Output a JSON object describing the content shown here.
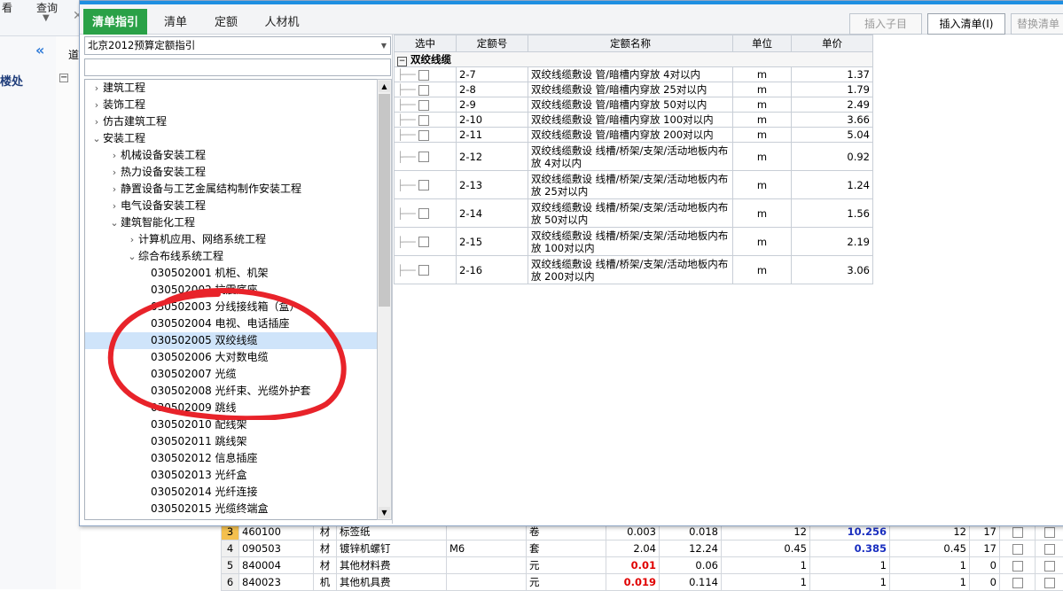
{
  "bg": {
    "toolbar_btn1": "看",
    "toolbar_btn2": "查询",
    "left_label": "楼处",
    "tab_fragment": "道"
  },
  "popup": {
    "tabs": [
      "清单指引",
      "清单",
      "定额",
      "人材机"
    ],
    "buttons": {
      "insert_child": "插入子目",
      "insert_list": "插入清单(I)",
      "replace_list": "替换清单"
    },
    "combo_value": "北京2012预算定额指引",
    "tree": [
      {
        "label": "建筑工程",
        "arrow": ">"
      },
      {
        "label": "装饰工程",
        "arrow": ">"
      },
      {
        "label": "仿古建筑工程",
        "arrow": ">"
      },
      {
        "label": "安装工程",
        "arrow": "v"
      },
      {
        "label": "机械设备安装工程",
        "arrow": ">"
      },
      {
        "label": "热力设备安装工程",
        "arrow": ">"
      },
      {
        "label": "静置设备与工艺金属结构制作安装工程",
        "arrow": ">"
      },
      {
        "label": "电气设备安装工程",
        "arrow": ">"
      },
      {
        "label": "建筑智能化工程",
        "arrow": "v"
      },
      {
        "label": "计算机应用、网络系统工程",
        "arrow": ">"
      },
      {
        "label": "综合布线系统工程",
        "arrow": "v"
      },
      {
        "label": "030502001  机柜、机架",
        "arrow": ""
      },
      {
        "label": "030502002  抗震底座",
        "arrow": ""
      },
      {
        "label": "030502003  分线接线箱（盒）",
        "arrow": ""
      },
      {
        "label": "030502004  电视、电话插座",
        "arrow": ""
      },
      {
        "label": "030502005  双绞线缆",
        "arrow": ""
      },
      {
        "label": "030502006  大对数电缆",
        "arrow": ""
      },
      {
        "label": "030502007  光缆",
        "arrow": ""
      },
      {
        "label": "030502008  光纤束、光缆外护套",
        "arrow": ""
      },
      {
        "label": "030502009  跳线",
        "arrow": ""
      },
      {
        "label": "030502010  配线架",
        "arrow": ""
      },
      {
        "label": "030502011  跳线架",
        "arrow": ""
      },
      {
        "label": "030502012  信息插座",
        "arrow": ""
      },
      {
        "label": "030502013  光纤盒",
        "arrow": ""
      },
      {
        "label": "030502014  光纤连接",
        "arrow": ""
      },
      {
        "label": "030502015  光缆终端盒",
        "arrow": ""
      }
    ],
    "grid": {
      "headers": [
        "选中",
        "定额号",
        "定额名称",
        "单位",
        "单价"
      ],
      "group": "双绞线缆",
      "rows": [
        {
          "code": "2-7",
          "name": "双绞线缆敷设 管/暗槽内穿放 4对以内",
          "unit": "m",
          "price": "1.37"
        },
        {
          "code": "2-8",
          "name": "双绞线缆敷设 管/暗槽内穿放 25对以内",
          "unit": "m",
          "price": "1.79"
        },
        {
          "code": "2-9",
          "name": "双绞线缆敷设 管/暗槽内穿放 50对以内",
          "unit": "m",
          "price": "2.49"
        },
        {
          "code": "2-10",
          "name": "双绞线缆敷设 管/暗槽内穿放 100对以内",
          "unit": "m",
          "price": "3.66"
        },
        {
          "code": "2-11",
          "name": "双绞线缆敷设 管/暗槽内穿放 200对以内",
          "unit": "m",
          "price": "5.04"
        },
        {
          "code": "2-12",
          "name": "双绞线缆敷设 线槽/桥架/支架/活动地板内布放 4对以内",
          "unit": "m",
          "price": "0.92"
        },
        {
          "code": "2-13",
          "name": "双绞线缆敷设 线槽/桥架/支架/活动地板内布放 25对以内",
          "unit": "m",
          "price": "1.24"
        },
        {
          "code": "2-14",
          "name": "双绞线缆敷设 线槽/桥架/支架/活动地板内布放 50对以内",
          "unit": "m",
          "price": "1.56"
        },
        {
          "code": "2-15",
          "name": "双绞线缆敷设 线槽/桥架/支架/活动地板内布放 100对以内",
          "unit": "m",
          "price": "2.19"
        },
        {
          "code": "2-16",
          "name": "双绞线缆敷设 线槽/桥架/支架/活动地板内布放 200对以内",
          "unit": "m",
          "price": "3.06"
        }
      ]
    }
  },
  "bottom_rows": [
    {
      "n": "3",
      "code": "460100",
      "type": "材",
      "name": "标签纸",
      "spec": "",
      "unit": "卷",
      "a": "0.003",
      "b": "0.018",
      "c": "12",
      "d": "10.256",
      "e": "12",
      "f": "17"
    },
    {
      "n": "4",
      "code": "090503",
      "type": "材",
      "name": "镀锌机螺钉",
      "spec": "M6",
      "unit": "套",
      "a": "2.04",
      "b": "12.24",
      "c": "0.45",
      "d": "0.385",
      "e": "0.45",
      "f": "17"
    },
    {
      "n": "5",
      "code": "840004",
      "type": "材",
      "name": "其他材料费",
      "spec": "",
      "unit": "元",
      "a": "0.01",
      "b": "0.06",
      "c": "1",
      "d": "1",
      "e": "1",
      "f": "0"
    },
    {
      "n": "6",
      "code": "840023",
      "type": "机",
      "name": "其他机具费",
      "spec": "",
      "unit": "元",
      "a": "0.019",
      "b": "0.114",
      "c": "1",
      "d": "1",
      "e": "1",
      "f": "0"
    }
  ],
  "colors": {
    "accent": "#2aa147",
    "topbar": "#1e8fe1",
    "selection": "#cfe4fa",
    "red_value": "#e00000",
    "blue_value": "#1a2fc0"
  }
}
